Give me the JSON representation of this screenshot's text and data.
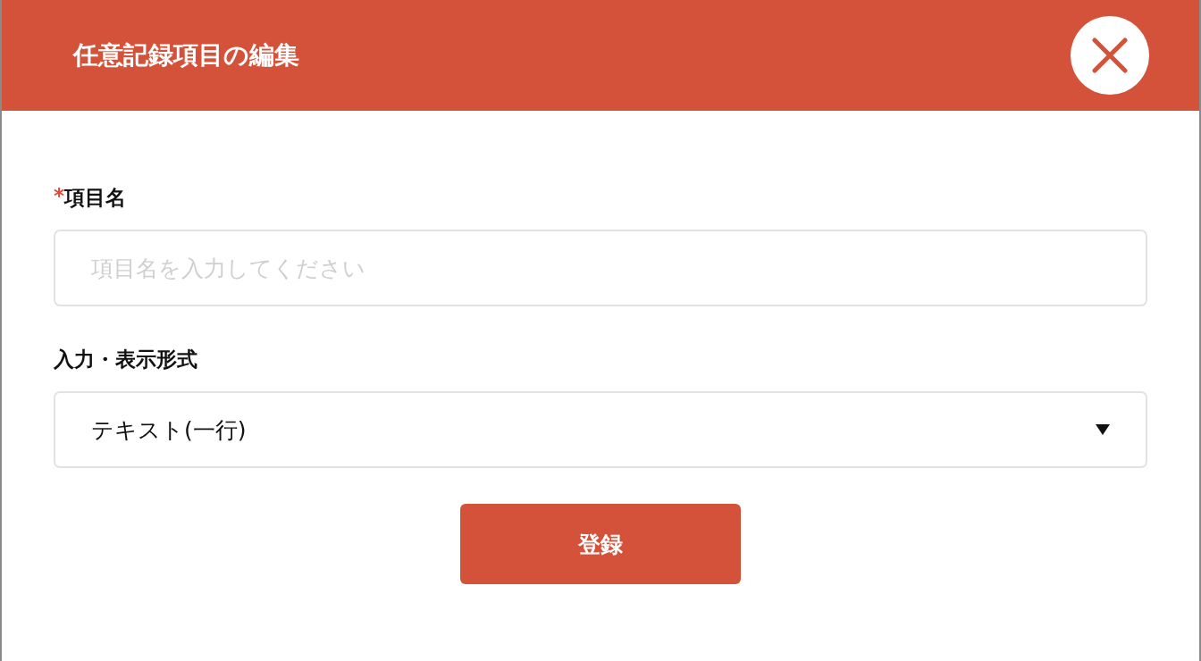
{
  "dialog": {
    "title": "任意記録項目の編集"
  },
  "fields": [
    {
      "kind": "text",
      "required_mark": "*",
      "label": "項目名",
      "placeholder": "項目名を入力してください"
    },
    {
      "kind": "select",
      "label": "入力・表示形式",
      "value": "テキスト(一行)"
    }
  ],
  "submit_button": {
    "label": "登録"
  }
}
